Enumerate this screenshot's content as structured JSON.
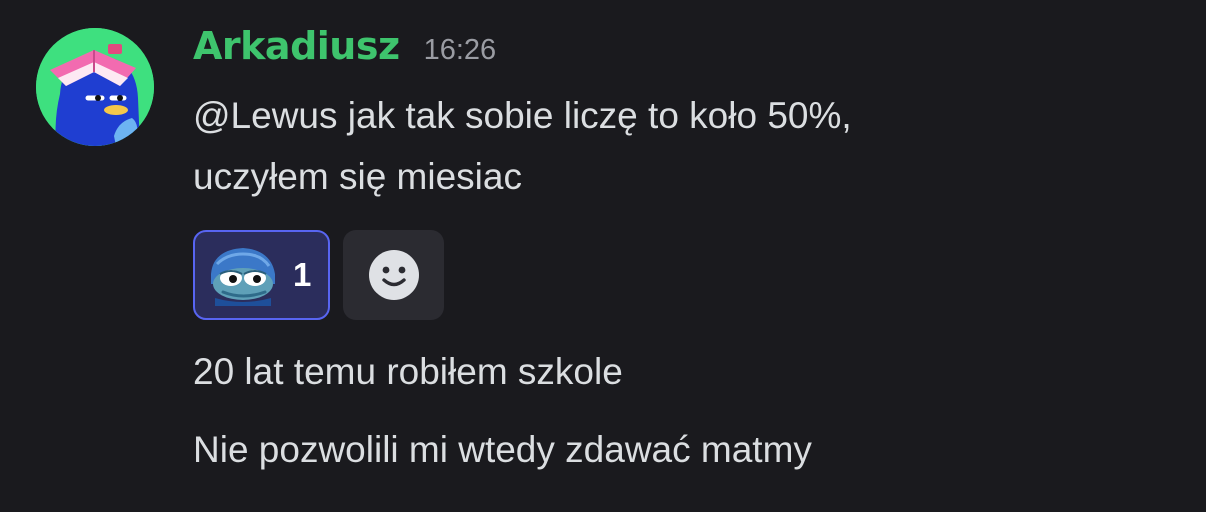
{
  "message": {
    "author": "Arkadiusz",
    "timestamp": "16:26",
    "author_color": "#3ec46d",
    "avatar_icon": "duck-with-book-avatar",
    "lines": [
      "@Lewus jak tak sobie liczę to koło 50%,",
      "uczyłem się miesiac"
    ],
    "reactions": [
      {
        "emoji": "pepe-frog-emoji",
        "count": "1",
        "reacted": true
      }
    ],
    "add_reaction_icon": "smiley-add-reaction-icon"
  },
  "followups": [
    "20 lat temu robiłem szkole",
    "Nie pozwolili mi wtedy zdawać matmy"
  ],
  "colors": {
    "background": "#1a1a1e",
    "text": "#dbdee1",
    "timestamp": "#9a9ca3",
    "reaction_border": "#5865f2",
    "reaction_bg": "#2b2d5c",
    "add_reaction_bg": "#2b2b31"
  }
}
